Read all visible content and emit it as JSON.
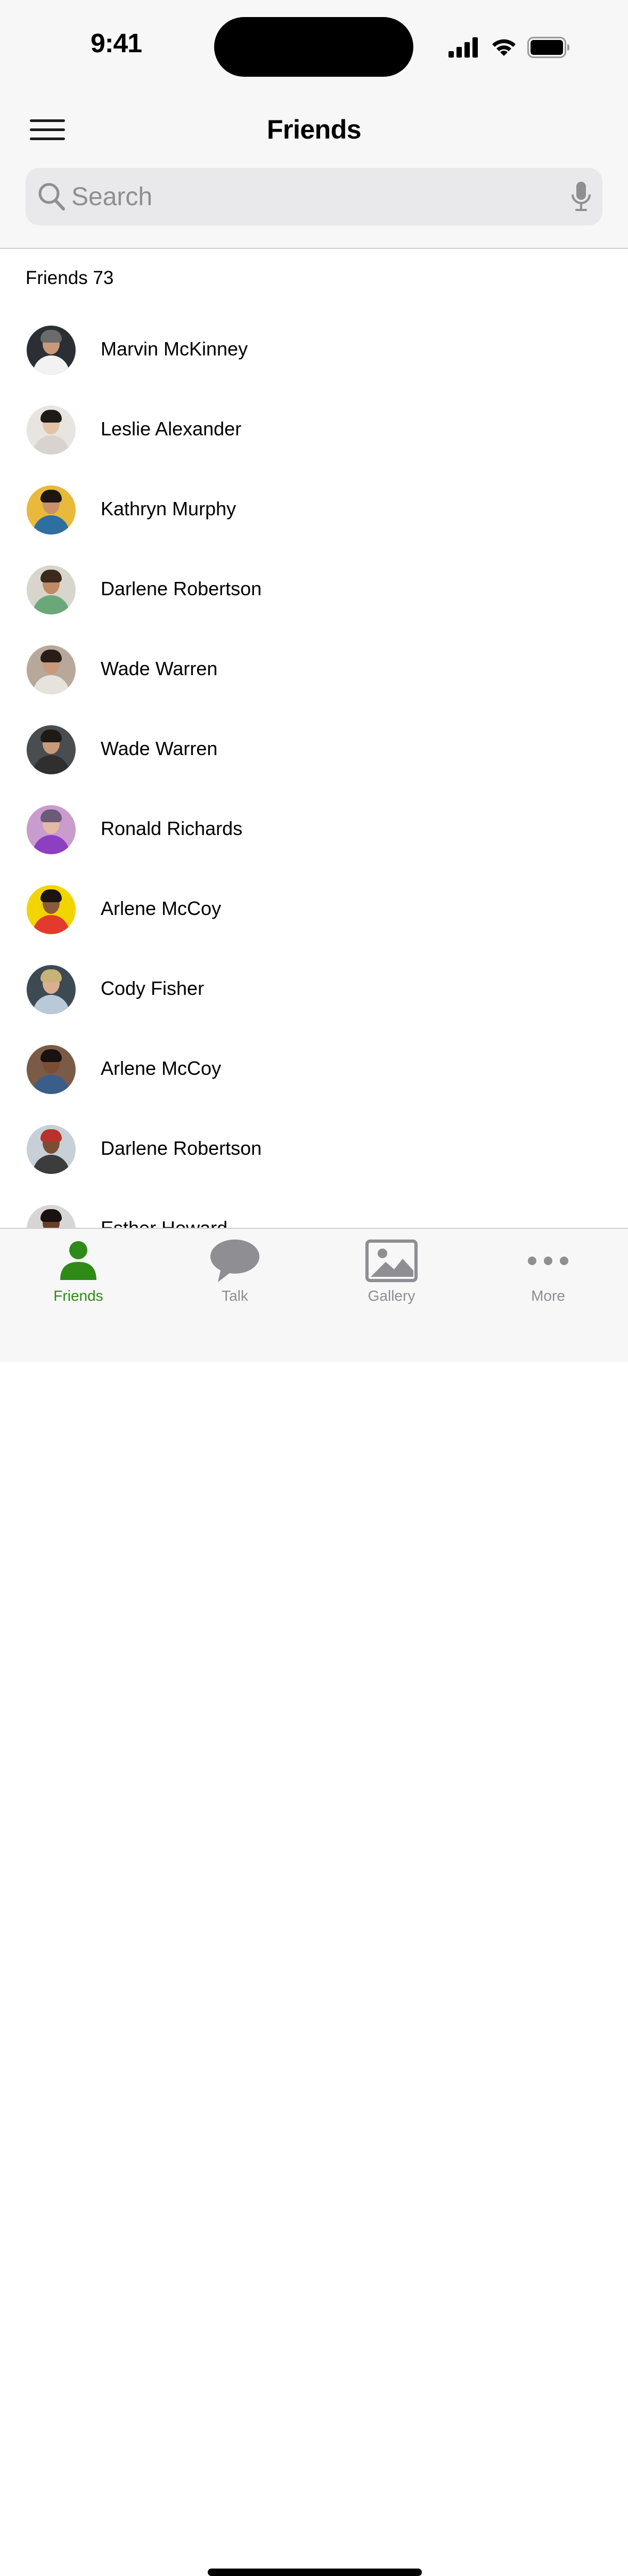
{
  "status_bar": {
    "time": "9:41"
  },
  "nav": {
    "title": "Friends",
    "menu_icon": "hamburger-icon"
  },
  "search": {
    "value": "",
    "placeholder": "Search",
    "icon": "search-icon",
    "mic_icon": "microphone-icon"
  },
  "section": {
    "header": "Friends 73"
  },
  "friends": [
    {
      "name": "Marvin McKinney",
      "avatar": {
        "bg": "#2b2f33",
        "skin": "#c99a7a",
        "hair": "#6b6b6b",
        "shirt": "#f2f2f2"
      }
    },
    {
      "name": "Leslie Alexander",
      "avatar": {
        "bg": "#e8e4e0",
        "skin": "#e3c2a8",
        "hair": "#1e1a18",
        "shirt": "#d8d3cf"
      }
    },
    {
      "name": "Kathryn Murphy",
      "avatar": {
        "bg": "#e8b93a",
        "skin": "#c9906b",
        "hair": "#1f1613",
        "shirt": "#2d6f9e"
      }
    },
    {
      "name": "Darlene Robertson",
      "avatar": {
        "bg": "#d8d5cc",
        "skin": "#c08a64",
        "hair": "#3b2a1e",
        "shirt": "#6aa87a"
      }
    },
    {
      "name": "Wade Warren",
      "avatar": {
        "bg": "#b7a89a",
        "skin": "#c9997a",
        "hair": "#2a1d15",
        "shirt": "#e6e2dc"
      }
    },
    {
      "name": "Wade Warren",
      "avatar": {
        "bg": "#4a4d4f",
        "skin": "#c99a7a",
        "hair": "#1d1a18",
        "shirt": "#2f2f2f"
      }
    },
    {
      "name": "Ronald Richards",
      "avatar": {
        "bg": "#c99ccd",
        "skin": "#e2bba3",
        "hair": "#6b5a7a",
        "shirt": "#8d3fc2"
      }
    },
    {
      "name": "Arlene McCoy",
      "avatar": {
        "bg": "#f2d400",
        "skin": "#8a5a3a",
        "hair": "#1c1411",
        "shirt": "#e23b2e"
      }
    },
    {
      "name": "Cody Fisher",
      "avatar": {
        "bg": "#3d4a52",
        "skin": "#d9b08f",
        "hair": "#c7b277",
        "shirt": "#b8c9d8"
      }
    },
    {
      "name": "Arlene McCoy",
      "avatar": {
        "bg": "#7a5b46",
        "skin": "#7a4e33",
        "hair": "#1a1210",
        "shirt": "#3a5d8a"
      }
    },
    {
      "name": "Darlene Robertson",
      "avatar": {
        "bg": "#c7d0d6",
        "skin": "#7a4e33",
        "hair": "#b8322c",
        "shirt": "#3c3c3c"
      }
    },
    {
      "name": "Esther Howard",
      "avatar": {
        "bg": "#d6d6d6",
        "skin": "#6a3f28",
        "hair": "#1a1210",
        "shirt": "#f2f2f2"
      }
    }
  ],
  "tabs": [
    {
      "label": "Friends",
      "icon": "person-icon",
      "active": true
    },
    {
      "label": "Talk",
      "icon": "chat-bubble-icon",
      "active": false
    },
    {
      "label": "Gallery",
      "icon": "image-icon",
      "active": false
    },
    {
      "label": "More",
      "icon": "ellipsis-icon",
      "active": false
    }
  ],
  "colors": {
    "accent": "#2f8a17",
    "inactive_tab": "#8e8e93",
    "bar_background": "#f7f7f7",
    "search_background": "#e9e9eb"
  }
}
